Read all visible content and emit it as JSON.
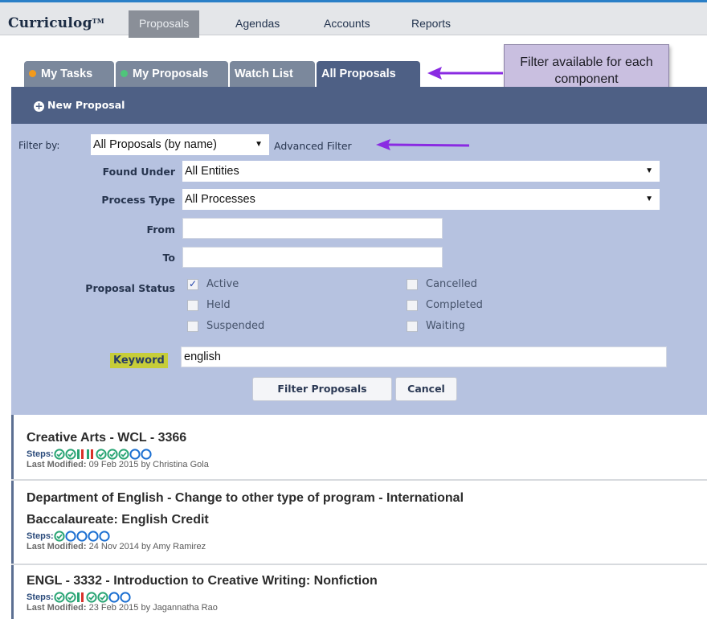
{
  "topnav": {
    "logo": "Curriculog",
    "logo_tm": "TM",
    "tabs": [
      {
        "label": "Proposals",
        "active": true
      },
      {
        "label": "Agendas",
        "active": false
      },
      {
        "label": "Accounts",
        "active": false
      },
      {
        "label": "Reports",
        "active": false
      }
    ]
  },
  "subtabs": [
    {
      "label": "My Tasks",
      "dot": "orange"
    },
    {
      "label": "My Proposals",
      "dot": "green"
    },
    {
      "label": "Watch List",
      "dot": null
    },
    {
      "label": "All Proposals",
      "dot": null,
      "selected": true
    }
  ],
  "callout": {
    "text": "Filter available for each component"
  },
  "panel": {
    "new_proposal_label": "New Proposal",
    "filter_by_label": "Filter by:",
    "filter_by_value": "All Proposals (by name)",
    "advanced_filter_label": "Advanced Filter",
    "found_under_label": "Found Under",
    "found_under_value": "All Entities",
    "process_type_label": "Process Type",
    "process_type_value": "All Processes",
    "from_label": "From",
    "from_value": "",
    "to_label": "To",
    "to_value": "",
    "proposal_status_label": "Proposal Status",
    "statuses": [
      {
        "label": "Active",
        "checked": true
      },
      {
        "label": "Cancelled",
        "checked": false
      },
      {
        "label": "Held",
        "checked": false
      },
      {
        "label": "Completed",
        "checked": false
      },
      {
        "label": "Suspended",
        "checked": false
      },
      {
        "label": "Waiting",
        "checked": false
      }
    ],
    "keyword_label": "Keyword",
    "keyword_value": "english",
    "filter_button": "Filter Proposals",
    "cancel_button": "Cancel"
  },
  "results": [
    {
      "title": "Creative Arts - WCL - 3366",
      "steps_label": "Steps:",
      "steps": [
        "done",
        "done",
        "rejected",
        "rejected",
        "done",
        "done",
        "done",
        "open",
        "open"
      ],
      "last_modified_label": "Last Modified:",
      "last_modified": "09 Feb 2015 by Christina Gola"
    },
    {
      "title_line1": "Department of English - Change to other type of program - International",
      "title_line2": "Baccalaureate: English Credit",
      "steps_label": "Steps:",
      "steps": [
        "done",
        "open",
        "open",
        "open",
        "open"
      ],
      "last_modified_label": "Last Modified:",
      "last_modified": "24 Nov 2014 by Amy Ramirez"
    },
    {
      "title": "ENGL - 3332 - Introduction to Creative Writing: Nonfiction",
      "steps_label": "Steps:",
      "steps": [
        "done",
        "done",
        "rejected",
        "done",
        "done",
        "open",
        "open"
      ],
      "last_modified_label": "Last Modified:",
      "last_modified": "23 Feb 2015 by Jagannatha Rao"
    }
  ],
  "colors": {
    "accent": "#4e6085",
    "panel_bg": "#b6c2e0",
    "callout_bg": "#c9bfe0",
    "arrow": "#8a2be2",
    "keyword_highlight": "#c6cd39",
    "step_done": "#2aa575",
    "step_open": "#1b6fd1",
    "step_rejected_green": "#2aa575",
    "step_rejected_red": "#d9302a"
  }
}
